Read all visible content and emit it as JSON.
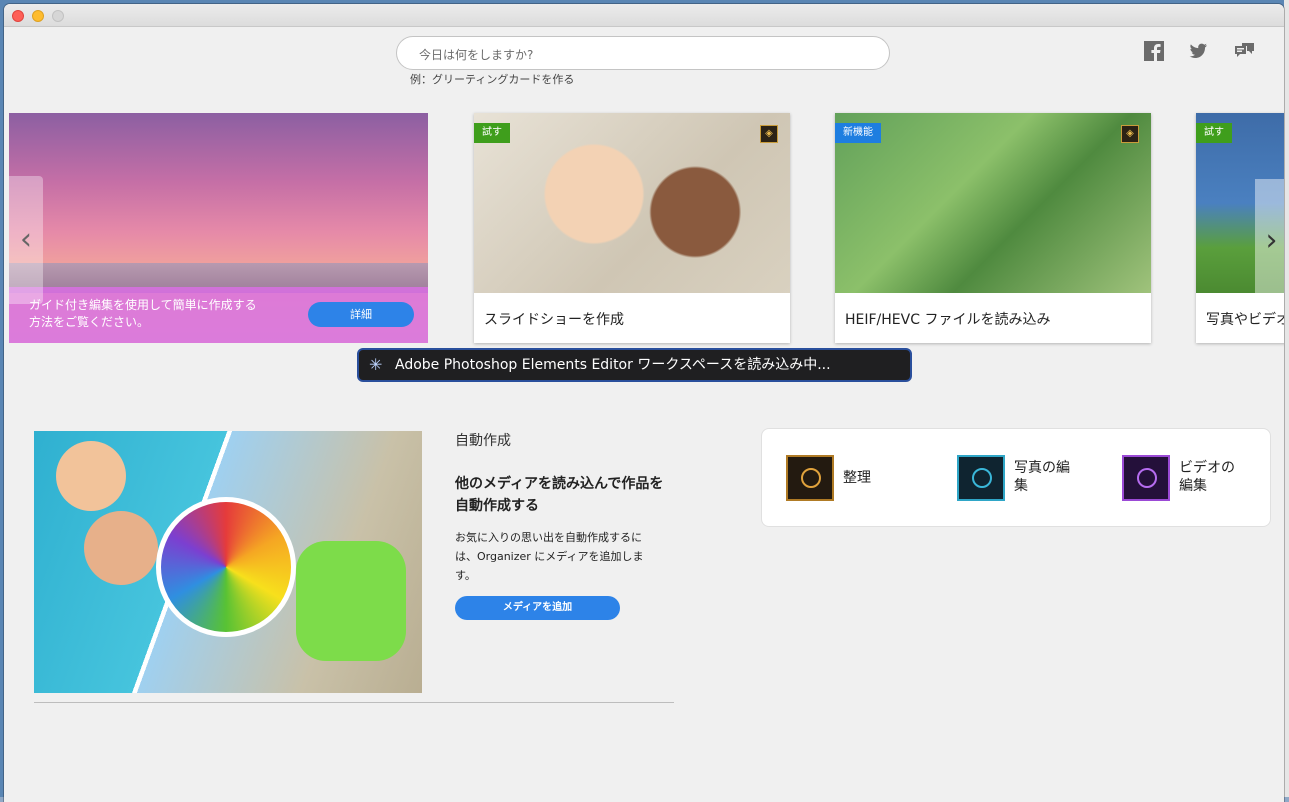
{
  "search": {
    "placeholder": "今日は何をしますか?",
    "hint": "例：グリーティングカードを作る"
  },
  "social": {
    "facebook": "facebook-icon",
    "twitter": "twitter-icon",
    "feedback": "feedback-icon"
  },
  "carousel": {
    "hero": {
      "caption": "ガイド付き編集を使用して簡単に作成する方法をご覧ください。",
      "button": "詳細"
    },
    "cards": [
      {
        "badge": "試す",
        "label": "スライドショーを作成"
      },
      {
        "badge": "新機能",
        "label": "HEIF/HEVC ファイルを読み込み"
      },
      {
        "badge": "試す",
        "label": "写真やビデオ"
      }
    ],
    "prev_arrow": "‹",
    "next_arrow": "›"
  },
  "loading": {
    "text": "Adobe Photoshop Elements Editor ワークスペースを読み込み中..."
  },
  "auto_creations": {
    "label": "自動作成",
    "heading": "他のメディアを読み込んで作品を自動作成する",
    "description": "お気に入りの思い出を自動作成するには、Organizer にメディアを追加します。",
    "button": "メディアを追加"
  },
  "apps": [
    {
      "label": "整理"
    },
    {
      "label": "写真の編集"
    },
    {
      "label": "ビデオの編集"
    }
  ],
  "colors": {
    "accent": "#2d83e8",
    "badge_try": "#3f9e1c",
    "badge_new": "#1e7ee0"
  }
}
